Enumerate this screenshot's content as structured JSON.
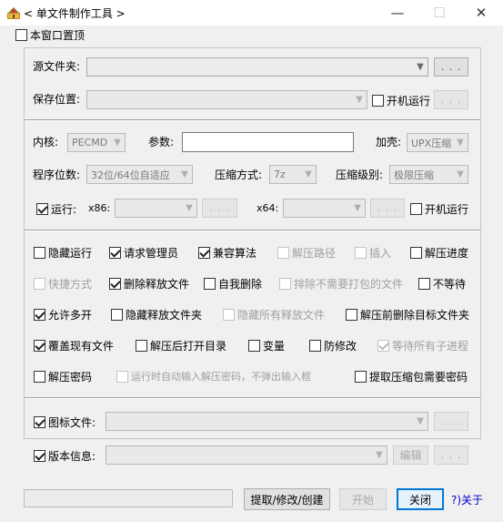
{
  "window": {
    "title": "< 单文件制作工具 >",
    "minimize": "—",
    "maximize": "☐",
    "close": "✕"
  },
  "topmost": {
    "label": "本窗口置顶",
    "checked": false
  },
  "source": {
    "label": "源文件夹:",
    "browse": ". . .",
    "save_label": "保存位置:",
    "save_browse": ". . .",
    "autorun_label": "开机运行"
  },
  "kernel": {
    "label": "内核:",
    "value": "PECMD",
    "params_label": "参数:",
    "params_value": "",
    "shell_label": "加壳:",
    "shell_value": "UPX压缩",
    "bits_label": "程序位数:",
    "bits_value": "32位/64位自适应",
    "compress_label": "压缩方式:",
    "compress_value": "7z",
    "level_label": "压缩级别:",
    "level_value": "极限压缩",
    "run_label": "运行:",
    "x86_label": "x86:",
    "x86_browse": ". . .",
    "x64_label": "x64:",
    "x64_browse": ". . .",
    "run_autorun_label": "开机运行"
  },
  "options": {
    "hide_run": "隐藏运行",
    "request_admin": "请求管理员",
    "compat_algo": "兼容算法",
    "extract_path": "解压路径",
    "insert": "插入",
    "extract_progress": "解压进度",
    "shortcut": "快捷方式",
    "delete_released": "删除释放文件",
    "self_delete": "自我删除",
    "exclude_unneeded": "排除不需要打包的文件",
    "no_wait": "不等待",
    "allow_multi": "允许多开",
    "hide_release_folder": "隐藏释放文件夹",
    "hide_all_released": "隐藏所有释放文件",
    "delete_target_before": "解压前删除目标文件夹",
    "overwrite_existing": "覆盖现有文件",
    "open_dir_after": "解压后打开目录",
    "variable": "变量",
    "anti_modify": "防修改",
    "wait_children": "等待所有子进程",
    "extract_password": "解压密码",
    "auto_password": "运行时自动输入解压密码，不弹出输入框",
    "extract_need_password": "提取压缩包需要密码"
  },
  "icon_file": {
    "label": "图标文件:",
    "browse": ". . ."
  },
  "version_info": {
    "label": "版本信息:",
    "edit": "编辑",
    "browse": ". . ."
  },
  "footer": {
    "extract_modify_create": "提取/修改/创建",
    "start": "开始",
    "close": "关闭",
    "about": "?)关于"
  }
}
